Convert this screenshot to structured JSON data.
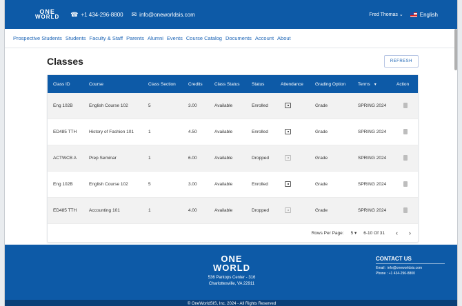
{
  "topbar": {
    "logo_line1": "ONE",
    "logo_line2": "WORLD",
    "phone": "+1 434-296-8800",
    "email": "info@oneworldsis.com",
    "user": "Fred Thomas",
    "language": "English"
  },
  "nav": [
    "Prospective Students",
    "Students",
    "Faculty & Staff",
    "Parents",
    "Alumni",
    "Events",
    "Course Catalog",
    "Documents",
    "Account",
    "About"
  ],
  "page_title": "Classes",
  "refresh_label": "REFRESH",
  "columns": [
    "Class ID",
    "Course",
    "Class Section",
    "Credits",
    "Class Status",
    "Status",
    "Attendance",
    "Grading Option",
    "Terms",
    "Action"
  ],
  "rows": [
    {
      "class_id": "Eng 102B",
      "course": "English Course 102",
      "section": "5",
      "credits": "3.00",
      "class_status": "Available",
      "status": "Enrolled",
      "grading": "Grade",
      "term": "SPRING 2024",
      "attendance_enabled": true
    },
    {
      "class_id": "ED485 TTH",
      "course": "History of Fashion 101",
      "section": "1",
      "credits": "4.50",
      "class_status": "Available",
      "status": "Enrolled",
      "grading": "Grade",
      "term": "SPRING 2024",
      "attendance_enabled": true
    },
    {
      "class_id": "ACTWCB A",
      "course": "Prep Seminar",
      "section": "1",
      "credits": "6.00",
      "class_status": "Available",
      "status": "Dropped",
      "grading": "Grade",
      "term": "SPRING 2024",
      "attendance_enabled": false
    },
    {
      "class_id": "Eng 102B",
      "course": "English Course 102",
      "section": "5",
      "credits": "3.00",
      "class_status": "Available",
      "status": "Enrolled",
      "grading": "Grade",
      "term": "SPRING 2024",
      "attendance_enabled": true
    },
    {
      "class_id": "ED485 TTH",
      "course": "Accounting 101",
      "section": "1",
      "credits": "4.00",
      "class_status": "Available",
      "status": "Dropped",
      "grading": "Grade",
      "term": "SPRING 2024",
      "attendance_enabled": false
    }
  ],
  "pagination": {
    "rows_per_page_label": "Rows Per Page:",
    "rows_per_page": "5",
    "range": "6-10 Of 31"
  },
  "footer": {
    "logo_line1": "ONE",
    "logo_line2": "WORLD",
    "address_line1": "536 Pantops Center - 316",
    "address_line2": "Charlottesville, VA 22911",
    "contact_title": "CONTACT US",
    "contact_email": "Email : info@oneworldsis.com",
    "contact_phone": "Phone : +1 434-296-8800",
    "copyright": "© OneWorldSIS, Inc. 2024 - All Rights Reserved"
  },
  "colors": {
    "brand_blue": "#0d5aa7",
    "link_blue": "#1a63b5"
  }
}
